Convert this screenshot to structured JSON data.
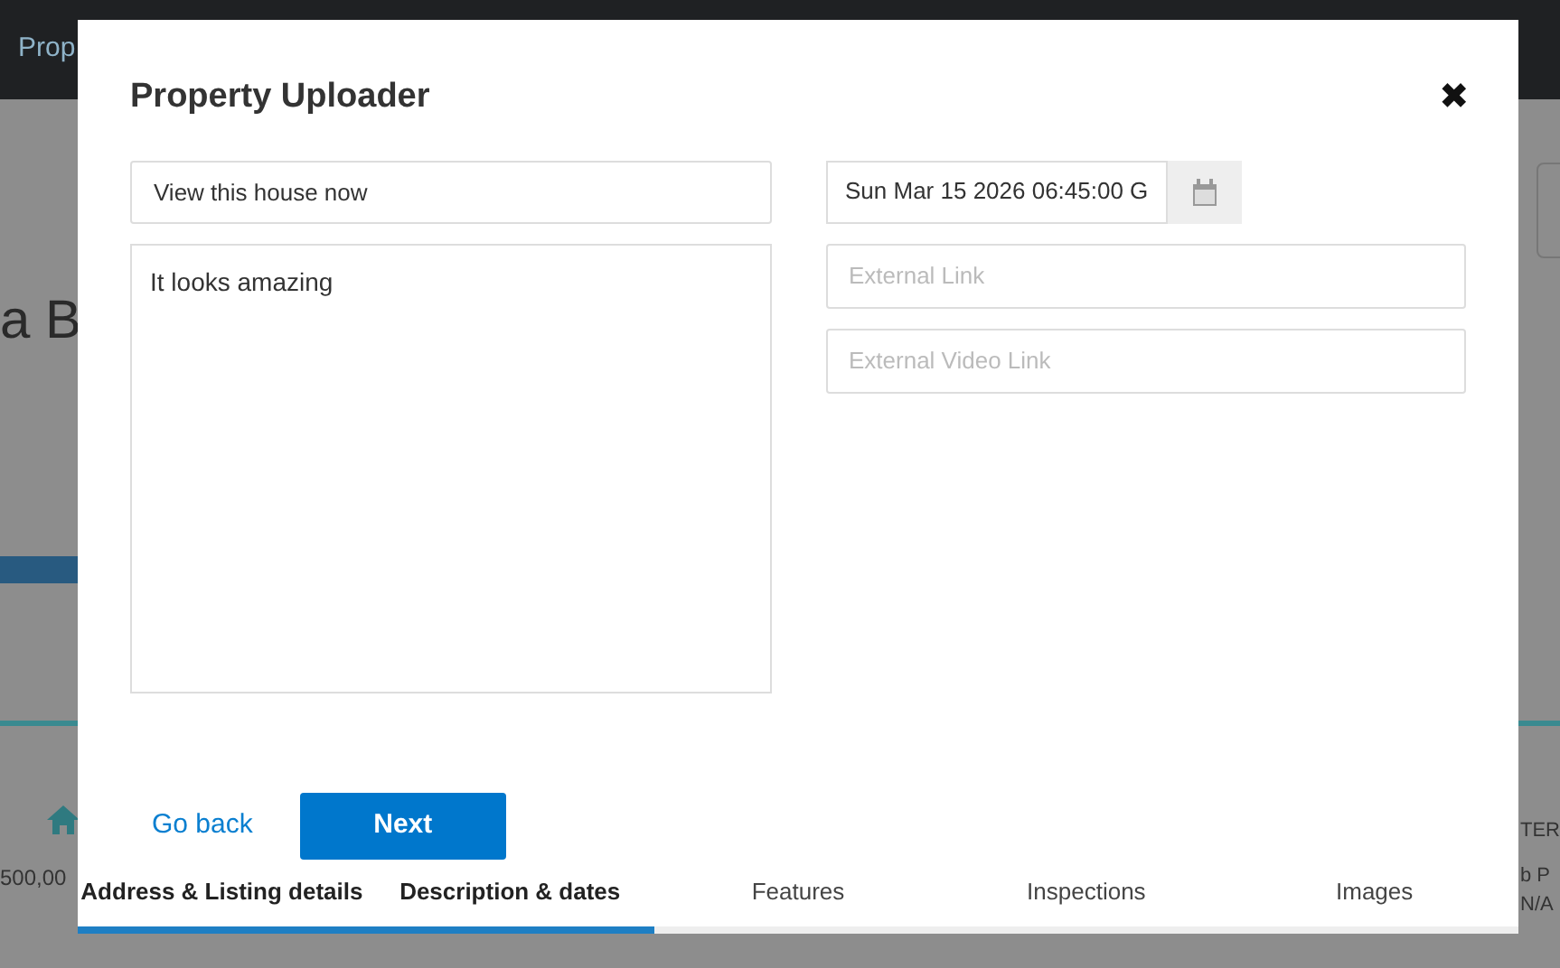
{
  "background": {
    "nav_text": "Prop",
    "heading_fragment": "a B",
    "price_fragment": "500,00",
    "right_label_fragment": "TER",
    "right_text_fragment": "b P",
    "right_value": "N/A"
  },
  "dialog": {
    "title": "Property Uploader",
    "close": "✖",
    "headline_field": {
      "value": "View this house now"
    },
    "description_field": {
      "value": "It looks amazing"
    },
    "date_field": {
      "value": "Sun Mar 15 2026 06:45:00 G"
    },
    "external_link_field": {
      "placeholder": "External Link"
    },
    "external_video_field": {
      "placeholder": "External Video Link"
    },
    "back_link": "Go back",
    "next_button": "Next",
    "steps": [
      {
        "label": "Address & Listing details",
        "done": true
      },
      {
        "label": "Description & dates",
        "done": true
      },
      {
        "label": "Features",
        "done": false
      },
      {
        "label": "Inspections",
        "done": false
      },
      {
        "label": "Images",
        "done": false
      }
    ],
    "progress": {
      "level": 0.4
    }
  }
}
